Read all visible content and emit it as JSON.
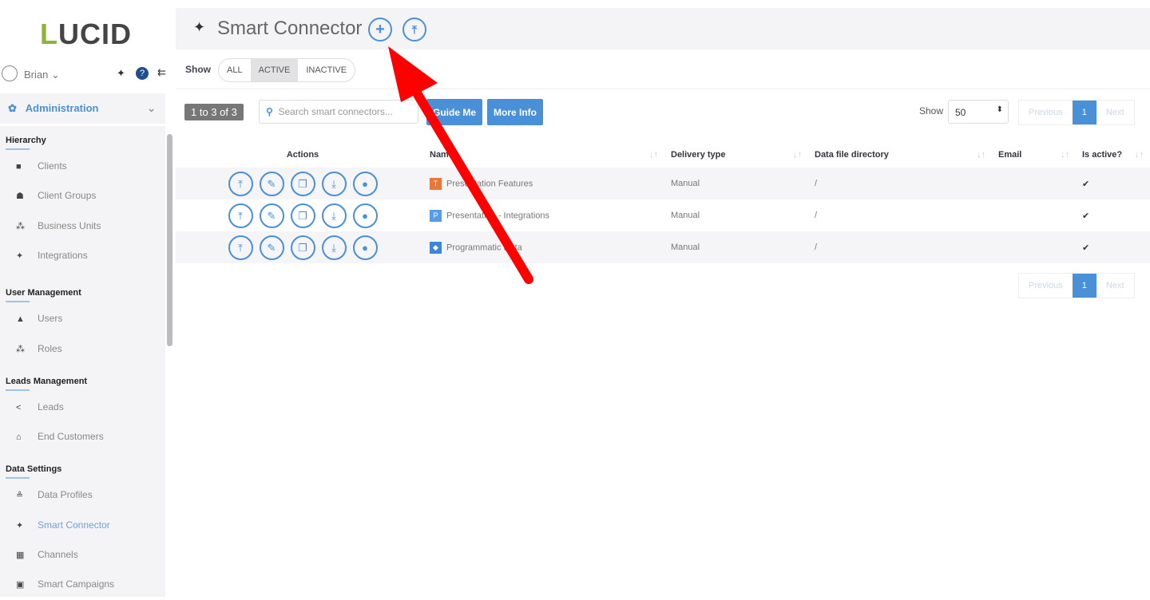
{
  "sidebar": {
    "logo": "LUCID",
    "user": "Brian",
    "section": "Administration",
    "groups": [
      {
        "title": "Hierarchy",
        "items": [
          {
            "icon": "briefcase-icon",
            "glyph": "■",
            "label": "Clients"
          },
          {
            "icon": "users-icon",
            "glyph": "☗",
            "label": "Client Groups"
          },
          {
            "icon": "sitemap-icon",
            "glyph": "⁂",
            "label": "Business Units"
          },
          {
            "icon": "plug-icon",
            "glyph": "✦",
            "label": "Integrations"
          }
        ]
      },
      {
        "title": "User Management",
        "items": [
          {
            "icon": "user-icon",
            "glyph": "▲",
            "label": "Users"
          },
          {
            "icon": "roles-icon",
            "glyph": "⁂",
            "label": "Roles"
          }
        ]
      },
      {
        "title": "Leads Management",
        "items": [
          {
            "icon": "share-icon",
            "glyph": "<",
            "label": "Leads"
          },
          {
            "icon": "end-customers-icon",
            "glyph": "⌂",
            "label": "End Customers"
          }
        ]
      },
      {
        "title": "Data Settings",
        "items": [
          {
            "icon": "data-profiles-icon",
            "glyph": "≗",
            "label": "Data Profiles"
          },
          {
            "icon": "plug-icon",
            "glyph": "✦",
            "label": "Smart Connector",
            "active": true
          },
          {
            "icon": "grid-icon",
            "glyph": "▦",
            "label": "Channels"
          },
          {
            "icon": "campaign-icon",
            "glyph": "▣",
            "label": "Smart Campaigns"
          }
        ]
      }
    ]
  },
  "header": {
    "title": "Smart Connector"
  },
  "filter": {
    "label": "Show",
    "options": [
      "ALL",
      "ACTIVE",
      "INACTIVE"
    ],
    "selected": "ACTIVE"
  },
  "toolbar": {
    "count": "1 to 3 of 3",
    "search_placeholder": "Search smart connectors...",
    "guide": "Guide Me",
    "more": "More Info",
    "show_label": "Show",
    "page_size": "50"
  },
  "pagination": {
    "prev": "Previous",
    "page": "1",
    "next": "Next"
  },
  "table": {
    "columns": [
      "Actions",
      "Name",
      "Delivery type",
      "Data file directory",
      "Email",
      "Is active?"
    ],
    "rows": [
      {
        "badge": "T",
        "badge_color": "#e8773a",
        "name": "Presentation Features",
        "delivery": "Manual",
        "dir": "/",
        "email": "",
        "active": "✔"
      },
      {
        "badge": "P",
        "badge_color": "#5b9be6",
        "name": "Presentation - Integrations",
        "delivery": "Manual",
        "dir": "/",
        "email": "",
        "active": "✔"
      },
      {
        "badge": "◆",
        "badge_color": "#3f86d4",
        "name": "Programmatic Data",
        "delivery": "Manual",
        "dir": "/",
        "email": "",
        "active": "✔"
      }
    ]
  },
  "colors": {
    "accent": "#4a90d9",
    "arrow": "#ff0000"
  }
}
